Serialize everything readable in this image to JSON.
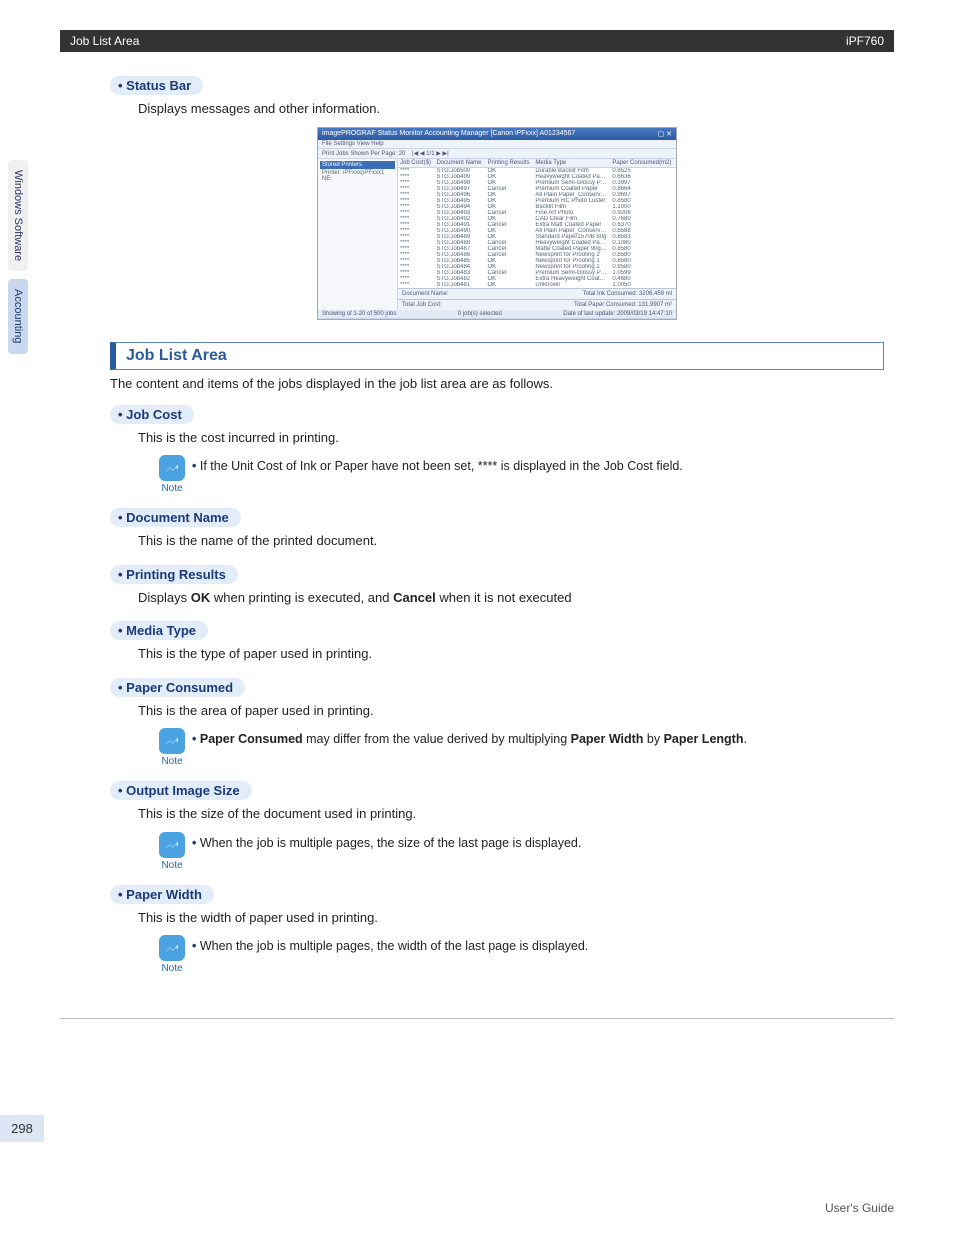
{
  "header": {
    "left": "Job List Area",
    "right": "iPF760"
  },
  "side_tabs": {
    "inactive": "Windows Software",
    "active": "Accounting"
  },
  "status_bar": {
    "title": "Status Bar",
    "desc": "Displays messages and other information."
  },
  "screenshot": {
    "window_title": "imagePROGRAF Status Monitor Accounting Manager [Canon iPFxxx]  A01234567",
    "menus": "File  Settings  View  Help",
    "toolbar_label": "Print Jobs Shown Per Page:",
    "pager": "1/1",
    "sidebar": {
      "top": "Stored Printers",
      "item": "Printer: iPFxxx(iPFxxx1 NE:"
    },
    "columns": [
      "Job Cost($)",
      "Document Name",
      "Printing Results",
      "Media Type",
      "Paper Consumed(m2)"
    ],
    "rows": [
      {
        "cost": "****",
        "doc": "STG:Job500",
        "result": "OK",
        "media": "Durable Backlit Film",
        "paper": "0.8525"
      },
      {
        "cost": "****",
        "doc": "STG:Job499",
        "result": "OK",
        "media": "Heavyweight Coated Paper",
        "paper": "0.6636"
      },
      {
        "cost": "****",
        "doc": "STG:Job498",
        "result": "OK",
        "media": "Premium Semi-Glossy Pa...",
        "paper": "0.3997"
      },
      {
        "cost": "****",
        "doc": "STG:Job497",
        "result": "Cancel",
        "media": "Premium Coated Paper",
        "paper": "0.8664"
      },
      {
        "cost": "****",
        "doc": "STG:Job496",
        "result": "OK",
        "media": "All Plain Paper_Conserve...",
        "paper": "0.9697"
      },
      {
        "cost": "****",
        "doc": "STG:Job495",
        "result": "OK",
        "media": "Premium RC Photo Luster",
        "paper": "0.8580"
      },
      {
        "cost": "****",
        "doc": "STG:Job494",
        "result": "OK",
        "media": "Backlit Film",
        "paper": "1.1000"
      },
      {
        "cost": "****",
        "doc": "STG:Job493",
        "result": "Cancel",
        "media": "Fine Art Photo",
        "paper": "0.9206"
      },
      {
        "cost": "****",
        "doc": "STG:Job492",
        "result": "OK",
        "media": "CAD Clear Film",
        "paper": "0.7680"
      },
      {
        "cost": "****",
        "doc": "STG:Job491",
        "result": "Cancel",
        "media": "Extra Matt Coated Paper",
        "paper": "0.6370"
      },
      {
        "cost": "****",
        "doc": "STG:Job490",
        "result": "OK",
        "media": "All Plain Paper_Conserve...",
        "paper": "0.8588"
      },
      {
        "cost": "****",
        "doc": "STG:Job489",
        "result": "OK",
        "media": "Standard Paper1570B 80g",
        "paper": "0.8583"
      },
      {
        "cost": "****",
        "doc": "STG:Job488",
        "result": "Cancel",
        "media": "Heavyweight Coated Paper",
        "paper": "0.1080"
      },
      {
        "cost": "****",
        "doc": "STG:Job487",
        "result": "Cancel",
        "media": "Matte Coated Paper 90gsm",
        "paper": "0.8580"
      },
      {
        "cost": "****",
        "doc": "STG:Job486",
        "result": "Cancel",
        "media": "Newsprint for Proofing 2",
        "paper": "0.8580"
      },
      {
        "cost": "****",
        "doc": "STG:Job485",
        "result": "OK",
        "media": "Newsprint for Proofing 1",
        "paper": "0.8580"
      },
      {
        "cost": "****",
        "doc": "STG:Job484",
        "result": "OK",
        "media": "Newsprint for Proofing 1",
        "paper": "0.8580"
      },
      {
        "cost": "****",
        "doc": "STG:Job483",
        "result": "Cancel",
        "media": "Premium Semi-Glossy Pa...",
        "paper": "1.0599"
      },
      {
        "cost": "****",
        "doc": "STG:Job482",
        "result": "OK",
        "media": "Extra Heavyweight Coat...",
        "paper": "0.4680"
      },
      {
        "cost": "****",
        "doc": "STG:Job481",
        "result": "OK",
        "media": "Unknown",
        "paper": "1.0050"
      }
    ],
    "summary": {
      "row1_left": "Document Name:",
      "row1_right": "Total Ink Consumed: 3206.459 ml",
      "row2_left": "Total Job Cost:",
      "row2_right": "Total Paper Consumed: 131.9907 m²"
    },
    "status": {
      "left": "Showing of 1-20 of 500 jobs",
      "mid": "0 job(s) selected",
      "right": "Date of last update: 2009/03/19 14:47:10"
    }
  },
  "section": {
    "heading": "Job List Area",
    "intro": "The content and items of the jobs displayed in the job list area are as follows."
  },
  "items": {
    "job_cost": {
      "title": "Job Cost",
      "desc": "This is the cost incurred in printing.",
      "note": "If the Unit Cost of Ink or Paper have not been set, **** is displayed in the Job Cost field."
    },
    "document_name": {
      "title": "Document Name",
      "desc": "This is the name of the printed document."
    },
    "printing_results": {
      "title": "Printing Results",
      "desc_pre": "Displays ",
      "ok": "OK",
      "desc_mid": " when printing is executed, and ",
      "cancel": "Cancel",
      "desc_post": " when it is not executed"
    },
    "media_type": {
      "title": "Media Type",
      "desc": "This is the type of paper used in printing."
    },
    "paper_consumed": {
      "title": "Paper Consumed",
      "desc": "This is the area of paper used in printing.",
      "note_b1": "Paper Consumed",
      "note_mid": " may differ from the value derived by multiplying ",
      "note_b2": "Paper Width",
      "note_by": " by ",
      "note_b3": "Paper Length",
      "note_end": "."
    },
    "output_image_size": {
      "title": "Output Image Size",
      "desc": "This is the size of the document used in printing.",
      "note": "When the job is multiple pages, the size of the last page is displayed."
    },
    "paper_width": {
      "title": "Paper Width",
      "desc": "This is the width of paper used in printing.",
      "note": "When the job is multiple pages, the width of the last page is displayed."
    }
  },
  "note_label": "Note",
  "page_number": "298",
  "footer": "User's Guide"
}
